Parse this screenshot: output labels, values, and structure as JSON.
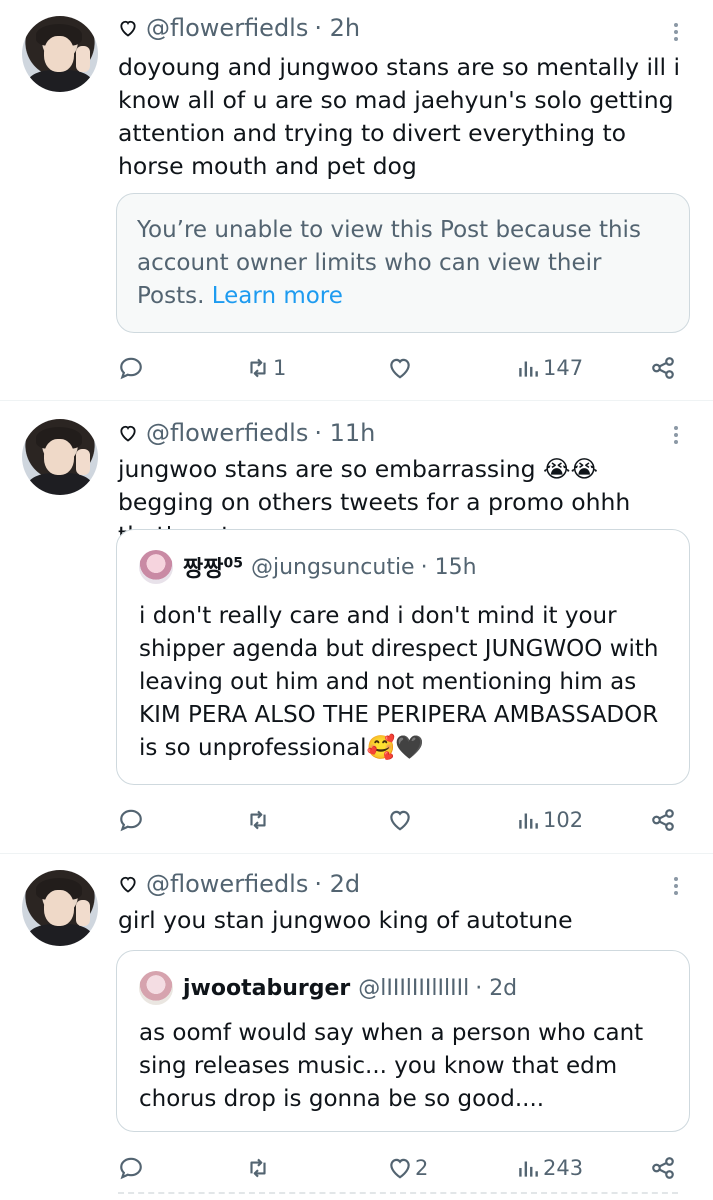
{
  "tweets": [
    {
      "handle": "@flowerfiedls",
      "time": "· 2h",
      "text": "doyoung and jungwoo stans are so mentally ill i know all of u are so mad jaehyun's solo getting attention and trying to divert everything to horse mouth and pet dog",
      "notice": {
        "text": "You’re unable to view this Post because this account owner limits who can view their Posts. ",
        "link": "Learn more"
      },
      "stats": {
        "replies": "",
        "reposts": "1",
        "likes": "",
        "views": "147"
      }
    },
    {
      "handle": "@flowerfiedls",
      "time": "· 11h",
      "text": "jungwoo stans are so embarrassing 😭😭 begging on others tweets for a promo ohhh that's not",
      "quote": {
        "name": "짱짱",
        "name_sup": "05",
        "handle": "@jungsuncutie",
        "time": "· 15h",
        "text": "i don't really care and i don't mind it your shipper agenda but direspect JUNGWOO with leaving out him and not mentioning him as KIM PERA ALSO THE PERIPERA AMBASSADOR is so unprofessional🥰🖤"
      },
      "stats": {
        "replies": "",
        "reposts": "",
        "likes": "",
        "views": "102"
      }
    },
    {
      "handle": "@flowerfiedls",
      "time": "· 2d",
      "text": "girl you stan jungwoo king of autotune",
      "quote": {
        "name": "jwootaburger",
        "handle": "@lIIIlIIIlIlIIl",
        "time": "· 2d",
        "text": "as oomf would say when a person who cant sing releases music... you know that edm chorus drop is gonna be so good...."
      },
      "stats": {
        "replies": "",
        "reposts": "",
        "likes": "2",
        "views": "243"
      }
    }
  ]
}
